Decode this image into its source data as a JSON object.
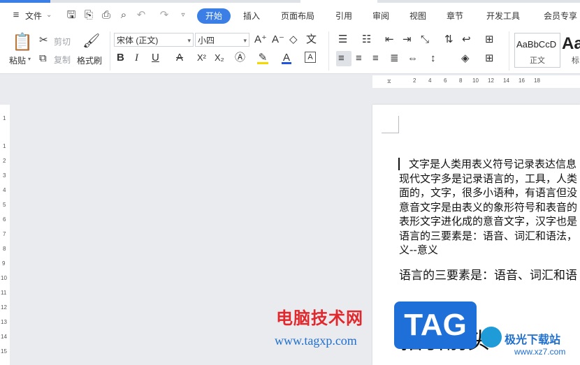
{
  "menu": {
    "file": "文件",
    "tabs": [
      "开始",
      "插入",
      "页面布局",
      "引用",
      "审阅",
      "视图",
      "章节",
      "开发工具",
      "会员专享"
    ],
    "active_tab": "开始"
  },
  "ribbon": {
    "paste": "粘贴",
    "cut": "剪切",
    "copy": "复制",
    "format_painter": "格式刷",
    "font_name": "宋体 (正文)",
    "font_size": "小四",
    "bold": "B",
    "italic": "I",
    "underline": "U",
    "strike": "A",
    "superscript": "X²",
    "subscript": "X₂",
    "style_normal_preview": "AaBbCcD",
    "style_normal_label": "正文",
    "style_heading_preview": "Aa",
    "style_heading_label": "标"
  },
  "ruler": {
    "h_numbers": [
      "2",
      "4",
      "6",
      "8",
      "10",
      "12",
      "14",
      "16",
      "18"
    ],
    "v_numbers": [
      "1",
      "2",
      "3",
      "4",
      "5",
      "6",
      "7",
      "8",
      "9",
      "10",
      "11",
      "12",
      "13",
      "14",
      "15"
    ]
  },
  "document": {
    "lines": [
      "文字是人类用表义符号记录表达信息",
      "现代文字多是记录语言的，工具，人类",
      "面的，文字，很多小语种，有语言但没",
      "意音文字是由表义的象形符号和表音的",
      "表形文字进化成的意音文字，汉字也是",
      "语言的三要素是：语音、词汇和语法，",
      "义--意义"
    ],
    "heading": "语言的三要素是：语音、词汇和语",
    "big_heading": "指引前头"
  },
  "watermark": {
    "site_cn": "电脑技术网",
    "site_url": "www.tagxp.com",
    "tag": "TAG",
    "xz_cn": "极光下载站",
    "xz_url": "www.xz7.com"
  }
}
